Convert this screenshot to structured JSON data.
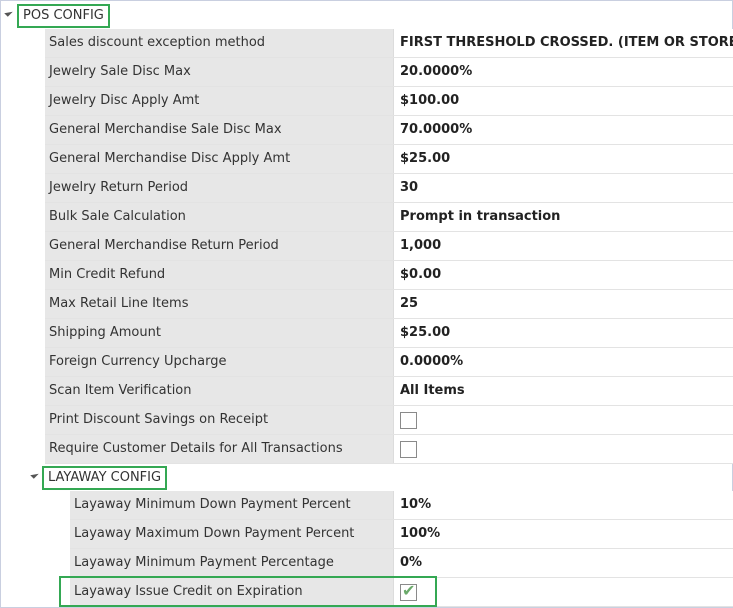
{
  "pos_section": {
    "label": "POS CONFIG",
    "rows": [
      {
        "name": "Sales discount exception method",
        "value": "FIRST THRESHOLD CROSSED. (ITEM OR STORE)"
      },
      {
        "name": "Jewelry Sale Disc Max",
        "value": "20.0000%"
      },
      {
        "name": "Jewelry Disc Apply Amt",
        "value": "$100.00"
      },
      {
        "name": "General Merchandise Sale Disc Max",
        "value": "70.0000%"
      },
      {
        "name": "General Merchandise Disc Apply Amt",
        "value": "$25.00"
      },
      {
        "name": "Jewelry Return Period",
        "value": "30"
      },
      {
        "name": "Bulk Sale Calculation",
        "value": "Prompt in transaction"
      },
      {
        "name": "General Merchandise Return Period",
        "value": "1,000"
      },
      {
        "name": "Min Credit Refund",
        "value": "$0.00"
      },
      {
        "name": "Max Retail Line Items",
        "value": "25"
      },
      {
        "name": "Shipping Amount",
        "value": "$25.00"
      },
      {
        "name": "Foreign Currency Upcharge",
        "value": "0.0000%"
      },
      {
        "name": "Scan Item Verification",
        "value": "All Items"
      },
      {
        "name": "Print Discount Savings on Receipt",
        "checkbox": false
      },
      {
        "name": "Require Customer Details for All Transactions",
        "checkbox": false
      }
    ]
  },
  "layaway_section": {
    "label": "LAYAWAY CONFIG",
    "rows": [
      {
        "name": "Layaway Minimum Down Payment Percent",
        "value": "10%"
      },
      {
        "name": "Layaway Maximum Down Payment Percent",
        "value": "100%"
      },
      {
        "name": "Layaway Minimum Payment Percentage",
        "value": "0%"
      },
      {
        "name": "Layaway Issue Credit on Expiration",
        "checkbox": true
      }
    ]
  },
  "colors": {
    "highlight": "#34a853",
    "name_cell_bg": "#e7e7e7",
    "check": "#6aaa6a"
  },
  "icons": {
    "expand_toggle": "expanded-triangle-icon",
    "checkmark": "checkmark-icon"
  }
}
